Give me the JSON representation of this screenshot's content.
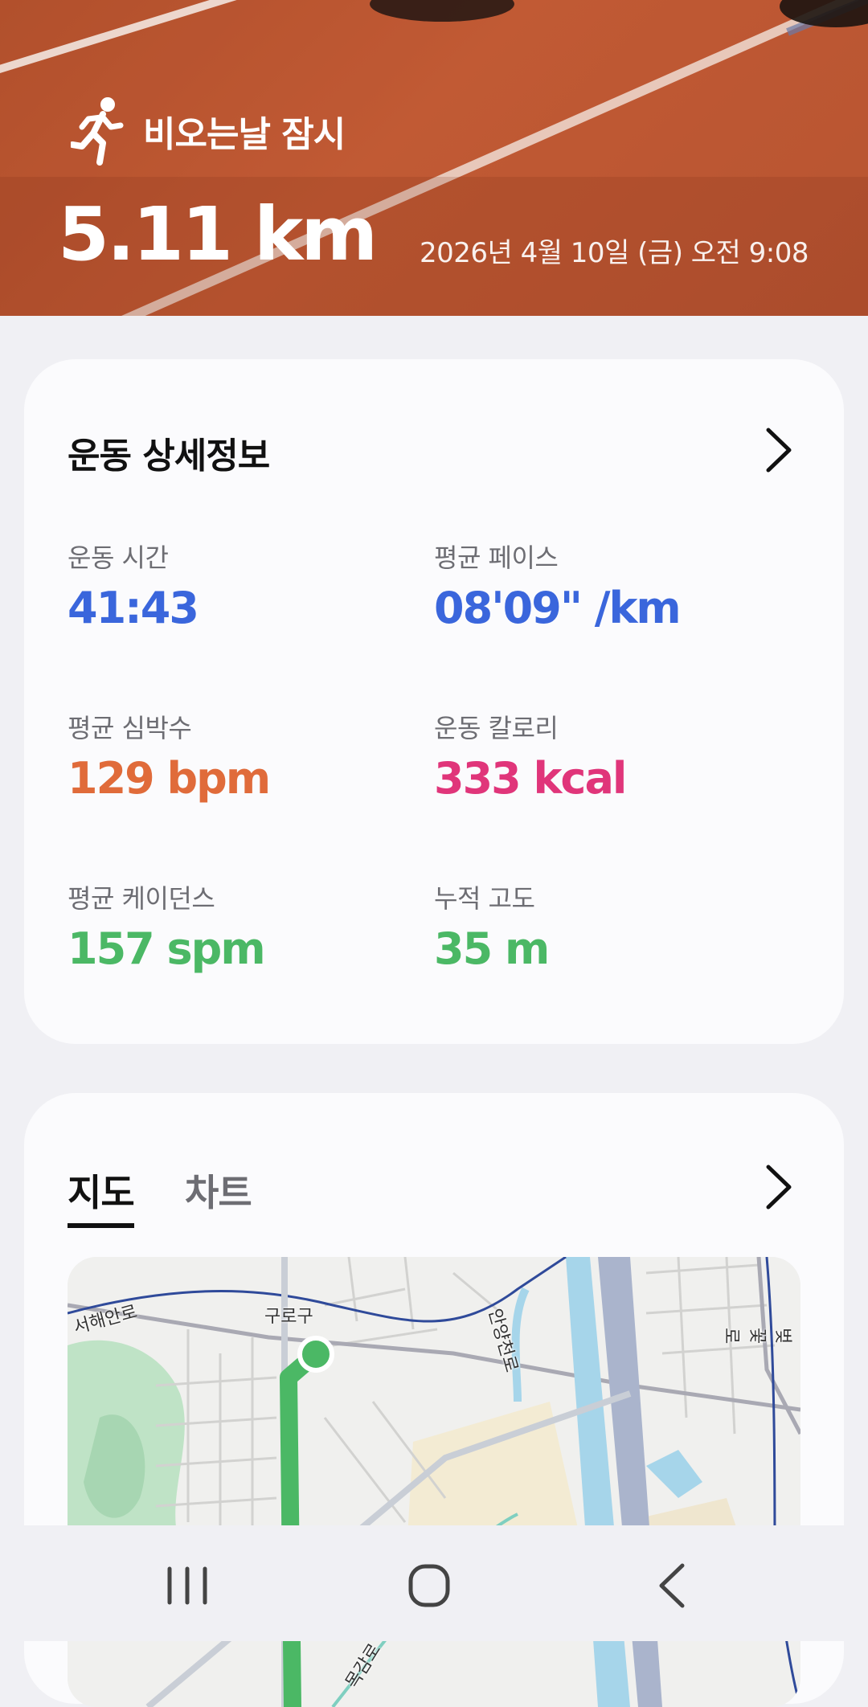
{
  "hero": {
    "activity_icon": "running-person-icon",
    "title": "비오는날 잠시",
    "distance": "5.11 km",
    "datetime": "2026년 4월 10일 (금) 오전 9:08"
  },
  "details": {
    "title": "운동 상세정보",
    "chevron_icon": "chevron-right-icon",
    "metrics": [
      {
        "label": "운동 시간",
        "value": "41:43",
        "color": "#3a66dc"
      },
      {
        "label": "평균 페이스",
        "value": "08'09\" /km",
        "color": "#3a66dc"
      },
      {
        "label": "평균 심박수",
        "value": "129 bpm",
        "color": "#e06b3a"
      },
      {
        "label": "운동 칼로리",
        "value": "333 kcal",
        "color": "#e0357a"
      },
      {
        "label": "평균 케이던스",
        "value": "157 spm",
        "color": "#4bb865"
      },
      {
        "label": "누적 고도",
        "value": "35 m",
        "color": "#4bb865"
      }
    ]
  },
  "map_card": {
    "tabs": [
      {
        "label": "지도",
        "selected": true
      },
      {
        "label": "차트",
        "selected": false
      }
    ],
    "chevron_icon": "chevron-right-icon",
    "map_labels": {
      "road1": "서해안로",
      "district": "구로구",
      "stream": "안양천로",
      "road2": "목감로",
      "road3": "벚꽃로",
      "contour": "100m"
    },
    "route_color": "#4bb865"
  },
  "navbar": {
    "recent_icon": "recent-apps-icon",
    "home_icon": "home-icon",
    "back_icon": "back-icon"
  }
}
